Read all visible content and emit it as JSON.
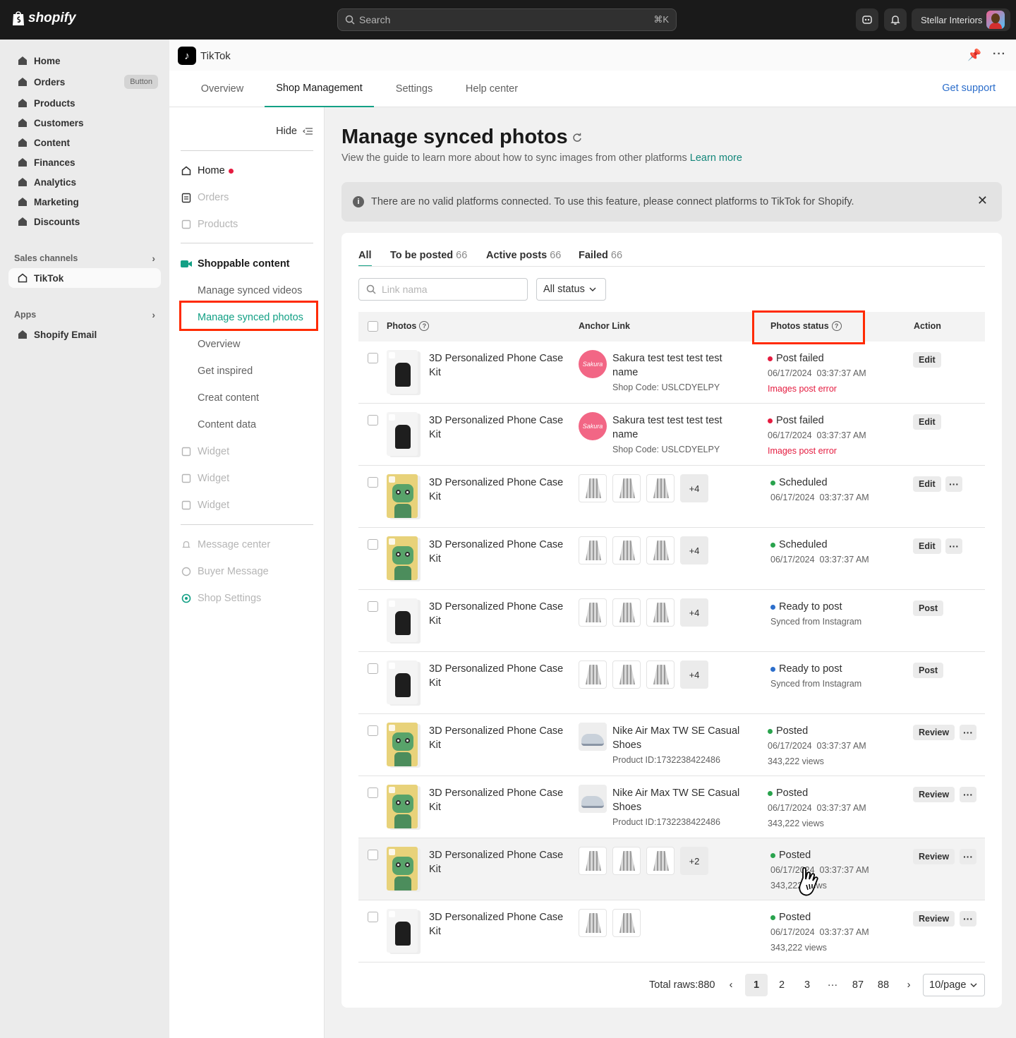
{
  "topbar": {
    "logo": "shopify",
    "search_placeholder": "Search",
    "search_shortcut": "⌘K",
    "store_name": "Stellar Interiors"
  },
  "sidebar": {
    "items": [
      {
        "label": "Home"
      },
      {
        "label": "Orders",
        "badge": "Button"
      },
      {
        "label": "Products"
      },
      {
        "label": "Customers"
      },
      {
        "label": "Content"
      },
      {
        "label": "Finances"
      },
      {
        "label": "Analytics"
      },
      {
        "label": "Marketing"
      },
      {
        "label": "Discounts"
      }
    ],
    "sales_channels_label": "Sales channels",
    "tiktok_label": "TikTok",
    "apps_label": "Apps",
    "shopify_email_label": "Shopify Email"
  },
  "app": {
    "title": "TikTok",
    "tabs": [
      "Overview",
      "Shop Management",
      "Settings",
      "Help center"
    ],
    "active_tab": "Shop Management",
    "get_support": "Get support"
  },
  "subnav": {
    "hide_label": "Hide",
    "home": "Home",
    "orders": "Orders",
    "products": "Products",
    "shoppable": "Shoppable content",
    "manage_videos": "Manage synced videos",
    "manage_photos": "Manage synced photos",
    "overview": "Overview",
    "get_inspired": "Get inspired",
    "create_content": "Creat content",
    "content_data": "Content data",
    "widget1": "Widget",
    "widget2": "Widget",
    "widget3": "Widget",
    "message_center": "Message center",
    "buyer_message": "Buyer Message",
    "shop_settings": "Shop Settings"
  },
  "page": {
    "title": "Manage synced photos",
    "subtitle": "View the guide to learn more about how to sync images from other platforms",
    "learn_more": "Learn more",
    "banner": "There are no valid platforms connected. To use this feature, please connect platforms to TikTok for Shopify."
  },
  "filters": {
    "tabs": [
      {
        "label": "All",
        "count": ""
      },
      {
        "label": "To be posted",
        "count": "66"
      },
      {
        "label": "Active posts",
        "count": "66"
      },
      {
        "label": "Failed",
        "count": "66"
      }
    ],
    "search_placeholder": "Link nama",
    "status_select": "All status"
  },
  "table": {
    "headers": {
      "photos": "Photos",
      "anchor": "Anchor Link",
      "status": "Photos status",
      "action": "Action"
    },
    "rows": [
      {
        "thumb": "jacket",
        "name": "3D Personalized Phone Case Kit",
        "anchor_type": "shop",
        "anchor_logo": "Sakura",
        "anchor_name": "Sakura test test test test name",
        "anchor_sub": "Shop Code: USLCDYELPY",
        "status": "Post failed",
        "status_color": "#e51c40",
        "line1": "06/17/2024  03:37:37 AM",
        "line2": "Images post error",
        "line2_error": true,
        "action": "Edit",
        "more": false
      },
      {
        "thumb": "jacket",
        "name": "3D Personalized Phone Case Kit",
        "anchor_type": "shop",
        "anchor_logo": "Sakura",
        "anchor_name": "Sakura test test test test name",
        "anchor_sub": "Shop Code: USLCDYELPY",
        "status": "Post failed",
        "status_color": "#e51c40",
        "line1": "06/17/2024  03:37:37 AM",
        "line2": "Images post error",
        "line2_error": true,
        "action": "Edit",
        "more": false
      },
      {
        "thumb": "robot",
        "name": "3D Personalized Phone Case Kit",
        "anchor_type": "images",
        "images": 3,
        "extra": "+4",
        "status": "Scheduled",
        "status_color": "#29a34d",
        "line1": "06/17/2024  03:37:37 AM",
        "line2": "",
        "action": "Edit",
        "more": true
      },
      {
        "thumb": "robot",
        "name": "3D Personalized Phone Case Kit",
        "anchor_type": "images",
        "images": 3,
        "extra": "+4",
        "status": "Scheduled",
        "status_color": "#29a34d",
        "line1": "06/17/2024  03:37:37 AM",
        "line2": "",
        "action": "Edit",
        "more": true
      },
      {
        "thumb": "jacket",
        "name": "3D Personalized Phone Case Kit",
        "anchor_type": "images",
        "images": 3,
        "extra": "+4",
        "status": "Ready to post",
        "status_color": "#2c6ecb",
        "line1": "Synced from Instagram",
        "line2": "",
        "action": "Post",
        "more": false
      },
      {
        "thumb": "jacket",
        "name": "3D Personalized Phone Case Kit",
        "anchor_type": "images",
        "images": 3,
        "extra": "+4",
        "status": "Ready to post",
        "status_color": "#2c6ecb",
        "line1": "Synced from Instagram",
        "line2": "",
        "action": "Post",
        "more": false
      },
      {
        "thumb": "robot",
        "name": "3D Personalized Phone Case Kit",
        "anchor_type": "product",
        "anchor_name": "Nike Air Max TW SE Casual Shoes",
        "anchor_sub": "Product ID:1732238422486",
        "status": "Posted",
        "status_color": "#29a34d",
        "line1": "06/17/2024  03:37:37 AM",
        "line2": "343,222 views",
        "action": "Review",
        "more": true
      },
      {
        "thumb": "robot",
        "name": "3D Personalized Phone Case Kit",
        "anchor_type": "product",
        "anchor_name": "Nike Air Max TW SE Casual Shoes",
        "anchor_sub": "Product ID:1732238422486",
        "status": "Posted",
        "status_color": "#29a34d",
        "line1": "06/17/2024  03:37:37 AM",
        "line2": "343,222 views",
        "action": "Review",
        "more": true
      },
      {
        "thumb": "robot",
        "name": "3D Personalized Phone Case Kit",
        "anchor_type": "images",
        "images": 3,
        "extra": "+2",
        "status": "Posted",
        "status_color": "#29a34d",
        "line1": "06/17/2024  03:37:37 AM",
        "line2": "343,222 views",
        "action": "Review",
        "more": true,
        "hover": true
      },
      {
        "thumb": "jacket",
        "name": "3D Personalized Phone Case Kit",
        "anchor_type": "images",
        "images": 2,
        "extra": "",
        "status": "Posted",
        "status_color": "#29a34d",
        "line1": "06/17/2024  03:37:37 AM",
        "line2": "343,222 views",
        "action": "Review",
        "more": true
      }
    ]
  },
  "pagination": {
    "total": "Total raws:880",
    "pages": [
      "1",
      "2",
      "3",
      "···",
      "87",
      "88"
    ],
    "active": "1",
    "per_page": "10/page"
  }
}
